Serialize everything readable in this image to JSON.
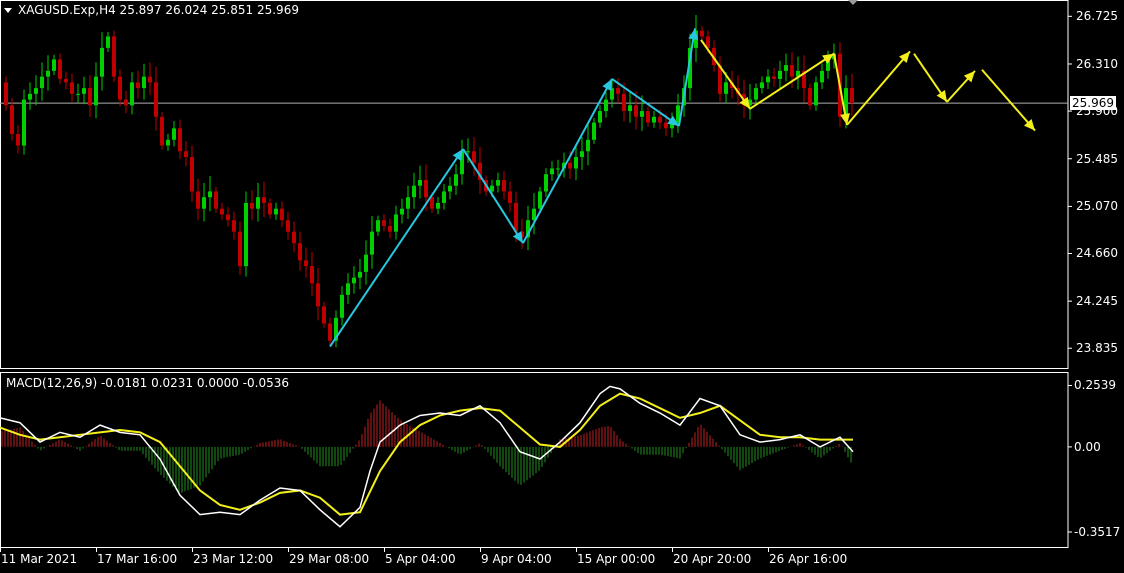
{
  "chart_data": {
    "type": "candlestick",
    "symbol_line": {
      "symbol": "XAGUSD.Exp,H4",
      "open": "25.897",
      "high": "26.024",
      "low": "25.851",
      "close": "25.969"
    },
    "price_axis": {
      "ticks": [
        "26.725",
        "26.310",
        "25.900",
        "25.485",
        "25.070",
        "24.660",
        "24.245",
        "23.835"
      ],
      "ylim": [
        23.75,
        26.78
      ],
      "current_price": "25.969"
    },
    "time_axis": {
      "ticks": [
        "11 Mar 2021",
        "17 Mar 16:00",
        "23 Mar 12:00",
        "29 Mar 08:00",
        "5 Apr 04:00",
        "9 Apr 04:00",
        "15 Apr 00:00",
        "20 Apr 20:00",
        "26 Apr 16:00"
      ]
    },
    "price_path": [
      [
        0,
        26.15
      ],
      [
        6,
        25.95
      ],
      [
        12,
        25.7
      ],
      [
        18,
        25.6
      ],
      [
        24,
        26.0
      ],
      [
        30,
        26.05
      ],
      [
        36,
        26.1
      ],
      [
        42,
        26.2
      ],
      [
        48,
        26.25
      ],
      [
        54,
        26.35
      ],
      [
        60,
        26.18
      ],
      [
        66,
        26.15
      ],
      [
        72,
        26.05
      ],
      [
        78,
        26.05
      ],
      [
        84,
        26.1
      ],
      [
        90,
        25.95
      ],
      [
        96,
        26.2
      ],
      [
        102,
        26.45
      ],
      [
        108,
        26.55
      ],
      [
        114,
        26.2
      ],
      [
        120,
        26.0
      ],
      [
        126,
        25.95
      ],
      [
        132,
        26.15
      ],
      [
        138,
        26.1
      ],
      [
        144,
        26.2
      ],
      [
        150,
        26.15
      ],
      [
        156,
        25.85
      ],
      [
        162,
        25.6
      ],
      [
        168,
        25.65
      ],
      [
        174,
        25.75
      ],
      [
        180,
        25.55
      ],
      [
        186,
        25.5
      ],
      [
        192,
        25.2
      ],
      [
        198,
        25.05
      ],
      [
        204,
        25.15
      ],
      [
        210,
        25.2
      ],
      [
        216,
        25.05
      ],
      [
        222,
        25.0
      ],
      [
        228,
        24.95
      ],
      [
        234,
        24.85
      ],
      [
        240,
        24.55
      ],
      [
        246,
        25.1
      ],
      [
        252,
        25.05
      ],
      [
        258,
        25.15
      ],
      [
        264,
        25.1
      ],
      [
        270,
        25.0
      ],
      [
        276,
        25.05
      ],
      [
        282,
        24.95
      ],
      [
        288,
        24.85
      ],
      [
        294,
        24.75
      ],
      [
        300,
        24.6
      ],
      [
        306,
        24.55
      ],
      [
        312,
        24.4
      ],
      [
        318,
        24.2
      ],
      [
        324,
        24.05
      ],
      [
        330,
        23.9
      ],
      [
        336,
        24.1
      ],
      [
        342,
        24.3
      ],
      [
        348,
        24.4
      ],
      [
        354,
        24.45
      ],
      [
        360,
        24.5
      ],
      [
        366,
        24.65
      ],
      [
        372,
        24.85
      ],
      [
        378,
        24.95
      ],
      [
        384,
        24.9
      ],
      [
        390,
        24.85
      ],
      [
        396,
        25.0
      ],
      [
        402,
        25.05
      ],
      [
        408,
        25.15
      ],
      [
        414,
        25.25
      ],
      [
        420,
        25.3
      ],
      [
        426,
        25.15
      ],
      [
        432,
        25.05
      ],
      [
        438,
        25.1
      ],
      [
        444,
        25.2
      ],
      [
        450,
        25.25
      ],
      [
        456,
        25.35
      ],
      [
        462,
        25.55
      ],
      [
        468,
        25.55
      ],
      [
        474,
        25.45
      ],
      [
        480,
        25.3
      ],
      [
        486,
        25.2
      ],
      [
        492,
        25.25
      ],
      [
        498,
        25.3
      ],
      [
        504,
        25.2
      ],
      [
        510,
        25.1
      ],
      [
        516,
        24.85
      ],
      [
        522,
        24.8
      ],
      [
        528,
        24.95
      ],
      [
        534,
        25.05
      ],
      [
        540,
        25.2
      ],
      [
        546,
        25.35
      ],
      [
        552,
        25.4
      ],
      [
        558,
        25.4
      ],
      [
        564,
        25.45
      ],
      [
        570,
        25.4
      ],
      [
        576,
        25.5
      ],
      [
        582,
        25.55
      ],
      [
        588,
        25.65
      ],
      [
        594,
        25.8
      ],
      [
        600,
        25.9
      ],
      [
        606,
        26.0
      ],
      [
        612,
        26.1
      ],
      [
        618,
        26.05
      ],
      [
        624,
        25.9
      ],
      [
        630,
        25.95
      ],
      [
        636,
        25.85
      ],
      [
        642,
        25.9
      ],
      [
        648,
        25.8
      ],
      [
        654,
        25.85
      ],
      [
        660,
        25.8
      ],
      [
        666,
        25.75
      ],
      [
        672,
        25.8
      ],
      [
        678,
        25.95
      ],
      [
        684,
        26.1
      ],
      [
        690,
        26.45
      ],
      [
        696,
        26.6
      ],
      [
        702,
        26.55
      ],
      [
        708,
        26.45
      ],
      [
        714,
        26.3
      ],
      [
        720,
        26.05
      ],
      [
        726,
        26.15
      ],
      [
        732,
        26.1
      ],
      [
        738,
        26.05
      ],
      [
        744,
        25.95
      ],
      [
        750,
        26.0
      ],
      [
        756,
        26.1
      ],
      [
        762,
        26.15
      ],
      [
        768,
        26.2
      ],
      [
        774,
        26.18
      ],
      [
        780,
        26.25
      ],
      [
        786,
        26.3
      ],
      [
        792,
        26.2
      ],
      [
        798,
        26.25
      ],
      [
        804,
        26.1
      ],
      [
        810,
        25.95
      ],
      [
        816,
        26.15
      ],
      [
        822,
        26.25
      ],
      [
        828,
        26.35
      ],
      [
        834,
        26.4
      ],
      [
        840,
        25.85
      ],
      [
        846,
        26.1
      ],
      [
        852,
        25.97
      ]
    ],
    "analysis_arrows": [
      {
        "color": "cyan",
        "points": [
          [
            330,
            23.85
          ],
          [
            463,
            25.57
          ]
        ]
      },
      {
        "color": "cyan",
        "points": [
          [
            463,
            25.57
          ],
          [
            523,
            24.75
          ]
        ]
      },
      {
        "color": "cyan",
        "points": [
          [
            523,
            24.75
          ],
          [
            612,
            26.18
          ]
        ]
      },
      {
        "color": "cyan",
        "points": [
          [
            612,
            26.18
          ],
          [
            679,
            25.77
          ]
        ]
      },
      {
        "color": "cyan",
        "points": [
          [
            679,
            25.77
          ],
          [
            695,
            26.62
          ]
        ]
      },
      {
        "color": "yellow",
        "points": [
          [
            701,
            26.52
          ],
          [
            750,
            25.92
          ]
        ]
      },
      {
        "color": "yellow",
        "points": [
          [
            750,
            25.92
          ],
          [
            834,
            26.4
          ]
        ]
      },
      {
        "color": "yellow",
        "points": [
          [
            834,
            26.4
          ],
          [
            847,
            25.78
          ]
        ]
      },
      {
        "color": "yellow",
        "points": [
          [
            847,
            25.78
          ],
          [
            910,
            26.42
          ]
        ]
      },
      {
        "color": "yellow",
        "points": [
          [
            914,
            26.4
          ],
          [
            947,
            25.98
          ]
        ]
      },
      {
        "color": "yellow",
        "points": [
          [
            947,
            25.98
          ],
          [
            975,
            26.25
          ]
        ]
      },
      {
        "color": "yellow",
        "points": [
          [
            982,
            26.26
          ],
          [
            1035,
            25.73
          ]
        ]
      }
    ],
    "macd": {
      "label": "MACD(12,26,9) -0.0181 0.0231 0.0000 -0.0536",
      "ticks": [
        "0.2539",
        "0.00",
        "-0.3517"
      ],
      "ylim": [
        -0.36,
        0.26
      ],
      "macd_line": [
        [
          0,
          0.12
        ],
        [
          20,
          0.1
        ],
        [
          40,
          0.02
        ],
        [
          60,
          0.06
        ],
        [
          80,
          0.04
        ],
        [
          100,
          0.09
        ],
        [
          120,
          0.06
        ],
        [
          140,
          0.05
        ],
        [
          160,
          -0.05
        ],
        [
          180,
          -0.2
        ],
        [
          200,
          -0.28
        ],
        [
          220,
          -0.27
        ],
        [
          240,
          -0.28
        ],
        [
          260,
          -0.22
        ],
        [
          280,
          -0.17
        ],
        [
          300,
          -0.18
        ],
        [
          320,
          -0.26
        ],
        [
          340,
          -0.33
        ],
        [
          360,
          -0.25
        ],
        [
          370,
          -0.1
        ],
        [
          380,
          0.02
        ],
        [
          400,
          0.09
        ],
        [
          420,
          0.13
        ],
        [
          440,
          0.14
        ],
        [
          460,
          0.13
        ],
        [
          480,
          0.17
        ],
        [
          500,
          0.1
        ],
        [
          520,
          -0.02
        ],
        [
          540,
          -0.05
        ],
        [
          560,
          0.02
        ],
        [
          580,
          0.1
        ],
        [
          600,
          0.22
        ],
        [
          610,
          0.25
        ],
        [
          620,
          0.24
        ],
        [
          640,
          0.18
        ],
        [
          660,
          0.14
        ],
        [
          680,
          0.09
        ],
        [
          700,
          0.2
        ],
        [
          720,
          0.17
        ],
        [
          740,
          0.05
        ],
        [
          760,
          0.02
        ],
        [
          780,
          0.03
        ],
        [
          800,
          0.05
        ],
        [
          820,
          0.0
        ],
        [
          840,
          0.04
        ],
        [
          853,
          -0.02
        ]
      ],
      "signal_line": [
        [
          0,
          0.08
        ],
        [
          20,
          0.05
        ],
        [
          40,
          0.03
        ],
        [
          60,
          0.04
        ],
        [
          80,
          0.05
        ],
        [
          100,
          0.06
        ],
        [
          120,
          0.07
        ],
        [
          140,
          0.06
        ],
        [
          160,
          0.02
        ],
        [
          180,
          -0.08
        ],
        [
          200,
          -0.18
        ],
        [
          220,
          -0.24
        ],
        [
          240,
          -0.26
        ],
        [
          260,
          -0.23
        ],
        [
          280,
          -0.19
        ],
        [
          300,
          -0.18
        ],
        [
          320,
          -0.21
        ],
        [
          340,
          -0.28
        ],
        [
          360,
          -0.27
        ],
        [
          380,
          -0.1
        ],
        [
          400,
          0.02
        ],
        [
          420,
          0.09
        ],
        [
          440,
          0.13
        ],
        [
          460,
          0.15
        ],
        [
          480,
          0.16
        ],
        [
          500,
          0.15
        ],
        [
          520,
          0.08
        ],
        [
          540,
          0.01
        ],
        [
          560,
          0.0
        ],
        [
          580,
          0.07
        ],
        [
          600,
          0.17
        ],
        [
          620,
          0.22
        ],
        [
          640,
          0.2
        ],
        [
          660,
          0.16
        ],
        [
          680,
          0.12
        ],
        [
          700,
          0.14
        ],
        [
          720,
          0.17
        ],
        [
          740,
          0.11
        ],
        [
          760,
          0.05
        ],
        [
          780,
          0.04
        ],
        [
          800,
          0.04
        ],
        [
          820,
          0.03
        ],
        [
          840,
          0.03
        ],
        [
          853,
          0.03
        ]
      ]
    }
  }
}
